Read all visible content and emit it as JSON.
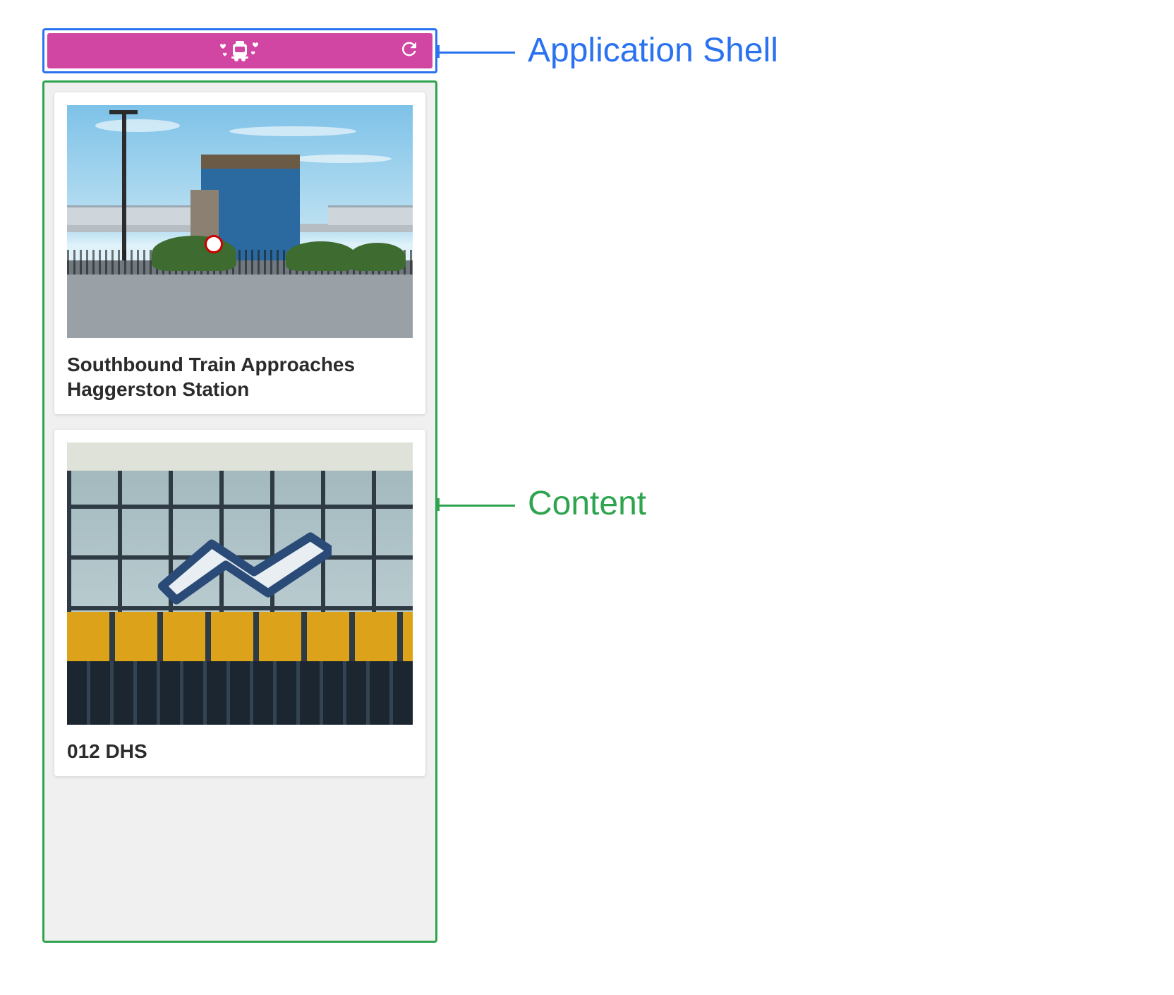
{
  "annotations": {
    "shell_label": "Application Shell",
    "content_label": "Content"
  },
  "app": {
    "logo_name": "train-hearts-icon",
    "refresh_name": "refresh-icon"
  },
  "cards": [
    {
      "title": "Southbound Train Approaches Haggerston Station"
    },
    {
      "title": "012 DHS"
    }
  ],
  "colors": {
    "shell_border": "#2a72f0",
    "content_border": "#2ea44f",
    "header_bg": "#d146a2"
  }
}
